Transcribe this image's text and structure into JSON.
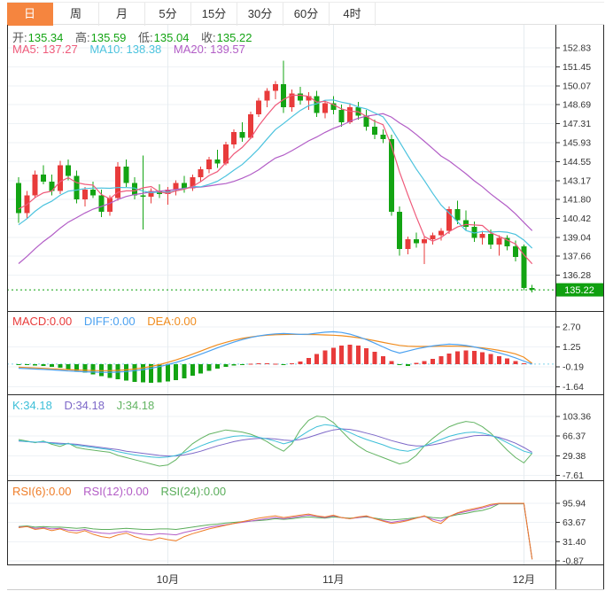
{
  "colors": {
    "up": "#e83b3b",
    "down": "#13a413",
    "tag": "#0fa00f",
    "tab_active": "#f5853f",
    "ma5": "#ef5a7a",
    "ma10": "#4cc3de",
    "ma20": "#b25dc6",
    "diff": "#4ba1f0",
    "dea": "#f08c1e",
    "k": "#3dbfd8",
    "d": "#7d68c8",
    "j": "#63b463",
    "rsi6": "#ef7d28",
    "rsi12": "#b35cc6",
    "rsi24": "#5aad5a",
    "grid": "#eef2f6",
    "vgrid": "#e6ecf0",
    "axis": "#2b2b2b",
    "tick_text": "#333333"
  },
  "toolbar": {
    "tabs": [
      {
        "label": "日",
        "active": true
      },
      {
        "label": "周",
        "active": false
      },
      {
        "label": "月",
        "active": false
      },
      {
        "label": "5分",
        "active": false
      },
      {
        "label": "15分",
        "active": false
      },
      {
        "label": "30分",
        "active": false
      },
      {
        "label": "60分",
        "active": false
      },
      {
        "label": "4时",
        "active": false
      }
    ]
  },
  "ohlc": {
    "open_label": "开:",
    "open": "135.34",
    "high_label": "高:",
    "high": "135.59",
    "low_label": "低:",
    "low": "135.04",
    "close_label": "收:",
    "close": "135.22"
  },
  "ma_row": {
    "ma5": "MA5: 137.27",
    "ma10": "MA10: 138.38",
    "ma20": "MA20: 139.57"
  },
  "macd_row": {
    "macd": "MACD:0.00",
    "diff": "DIFF:0.00",
    "dea": "DEA:0.00"
  },
  "kdj_row": {
    "k": "K:34.18",
    "d": "D:34.18",
    "j": "J:34.18"
  },
  "rsi_row": {
    "rsi6": "RSI(6):0.00",
    "rsi12": "RSI(12):0.00",
    "rsi24": "RSI(24):0.00"
  },
  "price_tag": "135.22",
  "chart_data": {
    "type": "candlestick",
    "panels": [
      {
        "name": "price",
        "type": "candlestick",
        "yticks": [
          "152.83",
          "151.45",
          "150.07",
          "148.69",
          "147.31",
          "145.93",
          "144.55",
          "143.17",
          "141.80",
          "140.42",
          "139.04",
          "137.66",
          "136.28"
        ],
        "current_price": 135.22,
        "ma_periods": [
          5,
          10,
          20
        ],
        "pre_closes": [
          131.0,
          131.6,
          132.2,
          132.8,
          133.4,
          134.0,
          134.6,
          135.2,
          135.8,
          136.4,
          137.0,
          137.6,
          138.2,
          138.8,
          139.4,
          140.0,
          140.5,
          141.0,
          141.4,
          141.8
        ],
        "candles": [
          [
            143.0,
            143.4,
            140.1,
            140.8
          ],
          [
            140.8,
            142.4,
            140.4,
            142.1
          ],
          [
            142.1,
            143.9,
            141.9,
            143.6
          ],
          [
            143.6,
            144.3,
            142.9,
            143.1
          ],
          [
            143.1,
            143.6,
            142.1,
            142.4
          ],
          [
            142.4,
            144.6,
            142.2,
            144.3
          ],
          [
            144.3,
            144.7,
            143.2,
            143.5
          ],
          [
            143.5,
            143.9,
            141.5,
            141.8
          ],
          [
            141.8,
            142.7,
            141.3,
            142.5
          ],
          [
            142.5,
            143.1,
            141.9,
            142.1
          ],
          [
            142.1,
            142.5,
            140.5,
            140.9
          ],
          [
            140.9,
            142.1,
            140.6,
            141.9
          ],
          [
            141.9,
            144.5,
            141.7,
            144.2
          ],
          [
            144.2,
            144.7,
            142.7,
            143.0
          ],
          [
            143.0,
            143.4,
            141.8,
            142.1
          ],
          [
            142.1,
            145.0,
            139.6,
            142.0
          ],
          [
            142.0,
            142.6,
            141.5,
            142.4
          ],
          [
            142.4,
            142.9,
            141.9,
            142.2
          ],
          [
            142.2,
            142.7,
            141.4,
            142.5
          ],
          [
            142.5,
            143.2,
            142.1,
            143.0
          ],
          [
            143.0,
            143.5,
            142.3,
            142.6
          ],
          [
            142.6,
            143.6,
            142.4,
            143.4
          ],
          [
            143.4,
            144.2,
            143.1,
            144.0
          ],
          [
            144.0,
            144.9,
            143.7,
            144.7
          ],
          [
            144.7,
            145.4,
            144.1,
            144.4
          ],
          [
            144.4,
            146.0,
            144.3,
            145.8
          ],
          [
            145.8,
            146.9,
            145.5,
            146.7
          ],
          [
            146.7,
            147.4,
            146.0,
            146.3
          ],
          [
            146.3,
            148.2,
            146.2,
            148.0
          ],
          [
            148.0,
            149.2,
            147.8,
            149.0
          ],
          [
            149.0,
            149.9,
            148.5,
            149.7
          ],
          [
            149.7,
            150.4,
            149.1,
            150.2
          ],
          [
            150.2,
            151.9,
            148.1,
            148.5
          ],
          [
            148.5,
            149.8,
            148.2,
            149.5
          ],
          [
            149.5,
            150.0,
            148.7,
            149.0
          ],
          [
            149.0,
            149.6,
            148.3,
            149.3
          ],
          [
            149.3,
            149.7,
            147.8,
            148.1
          ],
          [
            148.1,
            149.0,
            147.7,
            148.8
          ],
          [
            148.8,
            149.3,
            148.0,
            148.3
          ],
          [
            148.3,
            148.7,
            147.1,
            147.4
          ],
          [
            147.4,
            148.8,
            147.3,
            148.5
          ],
          [
            148.5,
            148.9,
            147.6,
            147.9
          ],
          [
            147.9,
            148.3,
            146.8,
            147.1
          ],
          [
            147.1,
            147.6,
            146.2,
            146.5
          ],
          [
            146.5,
            146.9,
            145.9,
            146.2
          ],
          [
            146.2,
            146.5,
            140.6,
            140.9
          ],
          [
            140.9,
            141.3,
            137.7,
            138.2
          ],
          [
            138.2,
            139.1,
            137.8,
            138.9
          ],
          [
            138.9,
            139.4,
            138.3,
            138.6
          ],
          [
            138.6,
            139.1,
            137.1,
            138.9
          ],
          [
            138.9,
            139.4,
            138.5,
            139.2
          ],
          [
            139.2,
            139.7,
            138.8,
            139.5
          ],
          [
            139.5,
            141.3,
            139.3,
            141.1
          ],
          [
            141.1,
            141.7,
            140.0,
            140.3
          ],
          [
            140.3,
            141.0,
            139.5,
            139.8
          ],
          [
            139.8,
            140.2,
            138.7,
            139.0
          ],
          [
            139.0,
            139.5,
            138.5,
            139.3
          ],
          [
            139.3,
            139.6,
            138.2,
            138.5
          ],
          [
            138.5,
            139.2,
            137.7,
            139.0
          ],
          [
            139.0,
            139.2,
            138.1,
            138.4
          ],
          [
            138.4,
            138.8,
            137.3,
            137.6
          ],
          [
            138.4,
            138.5,
            135.2,
            135.35
          ],
          [
            135.34,
            135.59,
            135.04,
            135.22
          ]
        ]
      },
      {
        "name": "macd",
        "type": "bar+line",
        "yticks": [
          "2.70",
          "1.25",
          "-0.19",
          "-1.64"
        ],
        "histogram": [
          -0.04,
          -0.07,
          -0.1,
          -0.14,
          -0.2,
          -0.28,
          -0.38,
          -0.5,
          -0.62,
          -0.75,
          -0.88,
          -1.0,
          -1.1,
          -1.2,
          -1.28,
          -1.33,
          -1.35,
          -1.33,
          -1.27,
          -1.17,
          -1.03,
          -0.86,
          -0.68,
          -0.5,
          -0.33,
          -0.19,
          -0.09,
          -0.02,
          0.04,
          0.07,
          0.05,
          0.02,
          -0.05,
          0.06,
          0.2,
          0.45,
          0.72,
          0.98,
          1.2,
          1.36,
          1.42,
          1.34,
          1.16,
          0.9,
          0.58,
          0.22,
          -0.07,
          -0.13,
          0.09,
          0.22,
          0.38,
          0.58,
          0.78,
          0.92,
          1.0,
          0.96,
          0.86,
          0.72,
          0.56,
          0.4,
          0.22,
          0.06,
          0.0
        ],
        "diff": [
          -0.3,
          -0.33,
          -0.36,
          -0.39,
          -0.42,
          -0.46,
          -0.5,
          -0.53,
          -0.56,
          -0.58,
          -0.6,
          -0.6,
          -0.58,
          -0.54,
          -0.48,
          -0.4,
          -0.3,
          -0.18,
          -0.04,
          0.12,
          0.3,
          0.5,
          0.72,
          0.95,
          1.18,
          1.4,
          1.6,
          1.78,
          1.93,
          2.05,
          2.14,
          2.2,
          2.22,
          2.2,
          2.16,
          2.18,
          2.25,
          2.32,
          2.35,
          2.3,
          2.18,
          2.0,
          1.78,
          1.52,
          1.25,
          0.98,
          0.8,
          0.95,
          1.1,
          1.22,
          1.32,
          1.4,
          1.45,
          1.42,
          1.35,
          1.25,
          1.12,
          0.98,
          0.82,
          0.65,
          0.45,
          0.22,
          0.0
        ],
        "dea": [
          -0.22,
          -0.25,
          -0.28,
          -0.31,
          -0.34,
          -0.37,
          -0.4,
          -0.43,
          -0.45,
          -0.47,
          -0.48,
          -0.48,
          -0.46,
          -0.42,
          -0.36,
          -0.28,
          -0.17,
          -0.04,
          0.12,
          0.3,
          0.5,
          0.72,
          0.95,
          1.18,
          1.4,
          1.58,
          1.74,
          1.87,
          1.97,
          2.05,
          2.1,
          2.13,
          2.15,
          2.16,
          2.16,
          2.15,
          2.14,
          2.12,
          2.1,
          2.06,
          2.0,
          1.92,
          1.82,
          1.7,
          1.58,
          1.46,
          1.36,
          1.3,
          1.28,
          1.28,
          1.29,
          1.3,
          1.31,
          1.3,
          1.28,
          1.24,
          1.18,
          1.1,
          1.0,
          0.88,
          0.74,
          0.5,
          0.05
        ]
      },
      {
        "name": "kdj",
        "type": "line",
        "yticks": [
          "103.36",
          "66.37",
          "29.38",
          "-7.61"
        ],
        "k": [
          58,
          56,
          55,
          56,
          53,
          51,
          52,
          49,
          47,
          45,
          43,
          41,
          37,
          34,
          31,
          29,
          27,
          26,
          27,
          30,
          35,
          41,
          48,
          54,
          59,
          63,
          66,
          67,
          66,
          64,
          61,
          57,
          52,
          56,
          66,
          76,
          84,
          88,
          86,
          80,
          73,
          66,
          60,
          55,
          50,
          44,
          40,
          38,
          42,
          48,
          54,
          60,
          66,
          70,
          73,
          74,
          72,
          68,
          62,
          54,
          46,
          38,
          34
        ],
        "d": [
          57,
          56,
          55,
          55,
          54,
          53,
          52,
          51,
          49,
          47,
          45,
          43,
          41,
          38,
          36,
          34,
          32,
          30,
          29,
          29,
          31,
          34,
          38,
          43,
          48,
          52,
          56,
          59,
          61,
          62,
          62,
          61,
          59,
          58,
          60,
          64,
          69,
          74,
          78,
          80,
          79,
          76,
          72,
          68,
          63,
          58,
          54,
          50,
          48,
          48,
          50,
          53,
          57,
          61,
          64,
          67,
          68,
          67,
          64,
          59,
          53,
          45,
          36
        ],
        "j": [
          60,
          57,
          54,
          57,
          51,
          47,
          53,
          45,
          42,
          40,
          38,
          36,
          30,
          26,
          22,
          18,
          14,
          10,
          12,
          22,
          38,
          52,
          62,
          70,
          74,
          78,
          76,
          74,
          70,
          64,
          56,
          46,
          38,
          52,
          78,
          96,
          104,
          102,
          92,
          76,
          60,
          48,
          38,
          32,
          26,
          20,
          14,
          18,
          30,
          48,
          62,
          74,
          84,
          90,
          94,
          92,
          84,
          72,
          56,
          40,
          26,
          16,
          34
        ]
      },
      {
        "name": "rsi",
        "type": "line",
        "yticks": [
          "95.94",
          "63.67",
          "31.40",
          "-0.87"
        ],
        "rsi6": [
          55,
          57,
          52,
          54,
          50,
          53,
          48,
          46,
          50,
          44,
          40,
          38,
          43,
          46,
          40,
          36,
          34,
          38,
          35,
          33,
          40,
          45,
          49,
          53,
          56,
          59,
          62,
          65,
          68,
          71,
          73,
          75,
          72,
          74,
          76,
          78,
          75,
          73,
          76,
          72,
          70,
          73,
          75,
          70,
          66,
          62,
          64,
          67,
          71,
          75,
          66,
          62,
          74,
          80,
          84,
          87,
          90,
          94,
          95.9,
          95.9,
          95.9,
          95.9,
          2
        ],
        "rsi12": [
          56,
          57,
          54,
          55,
          53,
          54,
          51,
          50,
          52,
          48,
          46,
          45,
          47,
          49,
          46,
          44,
          43,
          45,
          44,
          43,
          47,
          50,
          53,
          56,
          58,
          60,
          62,
          64,
          66,
          68,
          70,
          72,
          70,
          72,
          74,
          76,
          74,
          72,
          75,
          72,
          70,
          72,
          74,
          70,
          67,
          64,
          66,
          68,
          71,
          74,
          69,
          66,
          74,
          79,
          82,
          85,
          88,
          92,
          95.5,
          95.5,
          95.5,
          95.5,
          2
        ],
        "rsi24": [
          57,
          58,
          56,
          57,
          56,
          56,
          55,
          54,
          55,
          53,
          52,
          52,
          53,
          54,
          53,
          52,
          52,
          53,
          53,
          52,
          54,
          56,
          58,
          60,
          61,
          63,
          64,
          65,
          66,
          67,
          68,
          70,
          69,
          70,
          72,
          73,
          72,
          71,
          73,
          72,
          71,
          72,
          73,
          71,
          69,
          68,
          69,
          70,
          72,
          74,
          72,
          71,
          74,
          77,
          79,
          82,
          84,
          88,
          95,
          95,
          95,
          95,
          2
        ]
      }
    ],
    "x_axis": {
      "labels": [
        "10月",
        "11月",
        "12月"
      ],
      "month_indices": [
        18,
        38,
        61
      ]
    }
  }
}
